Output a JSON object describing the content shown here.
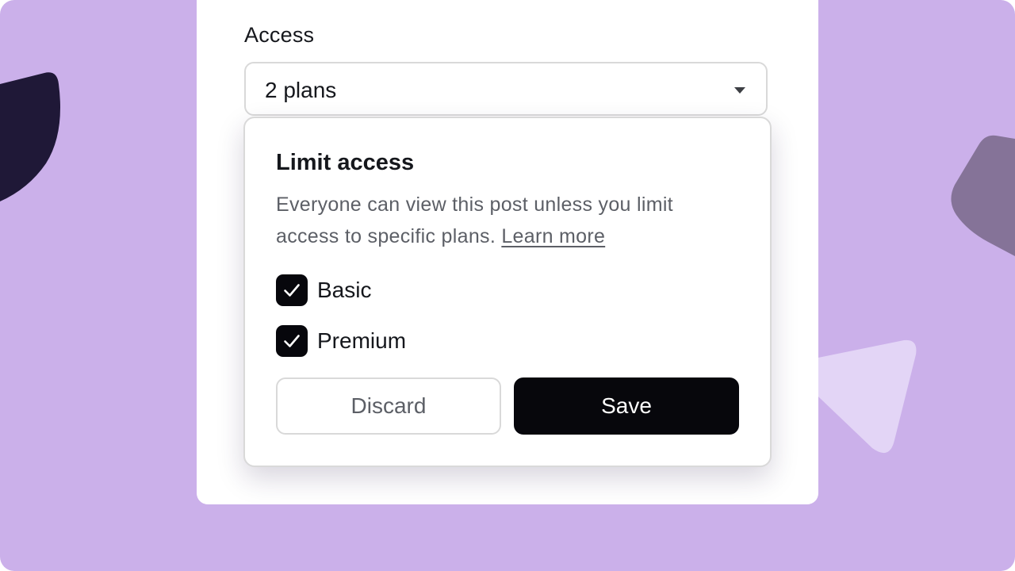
{
  "field": {
    "label": "Access",
    "selected_value": "2 plans"
  },
  "popover": {
    "title": "Limit access",
    "description": "Everyone can view this post unless you limit access to specific plans.",
    "link_label": "Learn more",
    "options": [
      {
        "label": "Basic",
        "checked": true
      },
      {
        "label": "Premium",
        "checked": true
      }
    ],
    "discard_label": "Discard",
    "save_label": "Save"
  },
  "colors": {
    "background": "#cbb0ea",
    "accent": "#07070c",
    "shape_dark": "#1f1837",
    "shape_mauve": "#857398",
    "shape_light": "#e3d5f6"
  }
}
